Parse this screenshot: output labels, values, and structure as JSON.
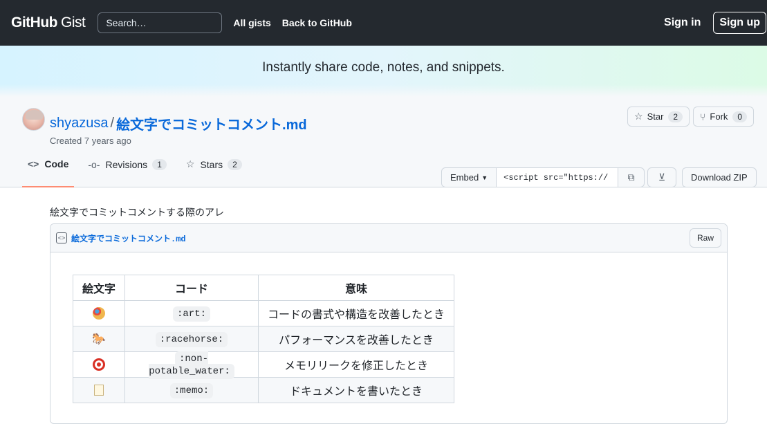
{
  "header": {
    "logo_main": "GitHub",
    "logo_sub": "Gist",
    "search_placeholder": "Search…",
    "nav": [
      "All gists",
      "Back to GitHub"
    ],
    "sign_in": "Sign in",
    "sign_up": "Sign up"
  },
  "banner": {
    "text": "Instantly share code, notes, and snippets."
  },
  "gist": {
    "owner": "shyazusa",
    "separator": "/",
    "filename": "絵文字でコミットコメント.md",
    "created": "Created 7 years ago",
    "star_label": "Star",
    "star_count": "2",
    "fork_label": "Fork",
    "fork_count": "0"
  },
  "tabs": [
    {
      "label": "Code",
      "icon": "code-icon",
      "active": true
    },
    {
      "label": "Revisions",
      "count": "1",
      "icon": "commit-icon"
    },
    {
      "label": "Stars",
      "count": "2",
      "icon": "star-icon"
    }
  ],
  "toolbar": {
    "embed_label": "Embed",
    "embed_value": "<script src=\"https://",
    "download_zip": "Download ZIP"
  },
  "description": "絵文字でコミットコメントする際のアレ",
  "file": {
    "name": "絵文字でコミットコメント.md",
    "raw_label": "Raw",
    "table": {
      "headers": [
        "絵文字",
        "コード",
        "意味"
      ],
      "rows": [
        {
          "emoji": "art-icon",
          "code": ":art:",
          "meaning": "コードの書式や構造を改善したとき"
        },
        {
          "emoji": "racehorse-icon",
          "code": ":racehorse:",
          "meaning": "パフォーマンスを改善したとき"
        },
        {
          "emoji": "non-potable-water-icon",
          "code": ":non-potable_water:",
          "meaning": "メモリリークを修正したとき"
        },
        {
          "emoji": "memo-icon",
          "code": ":memo:",
          "meaning": "ドキュメントを書いたとき"
        }
      ]
    }
  },
  "colors": {
    "header_bg": "#24292f",
    "link": "#0969da",
    "tab_active": "#fd8c73"
  }
}
